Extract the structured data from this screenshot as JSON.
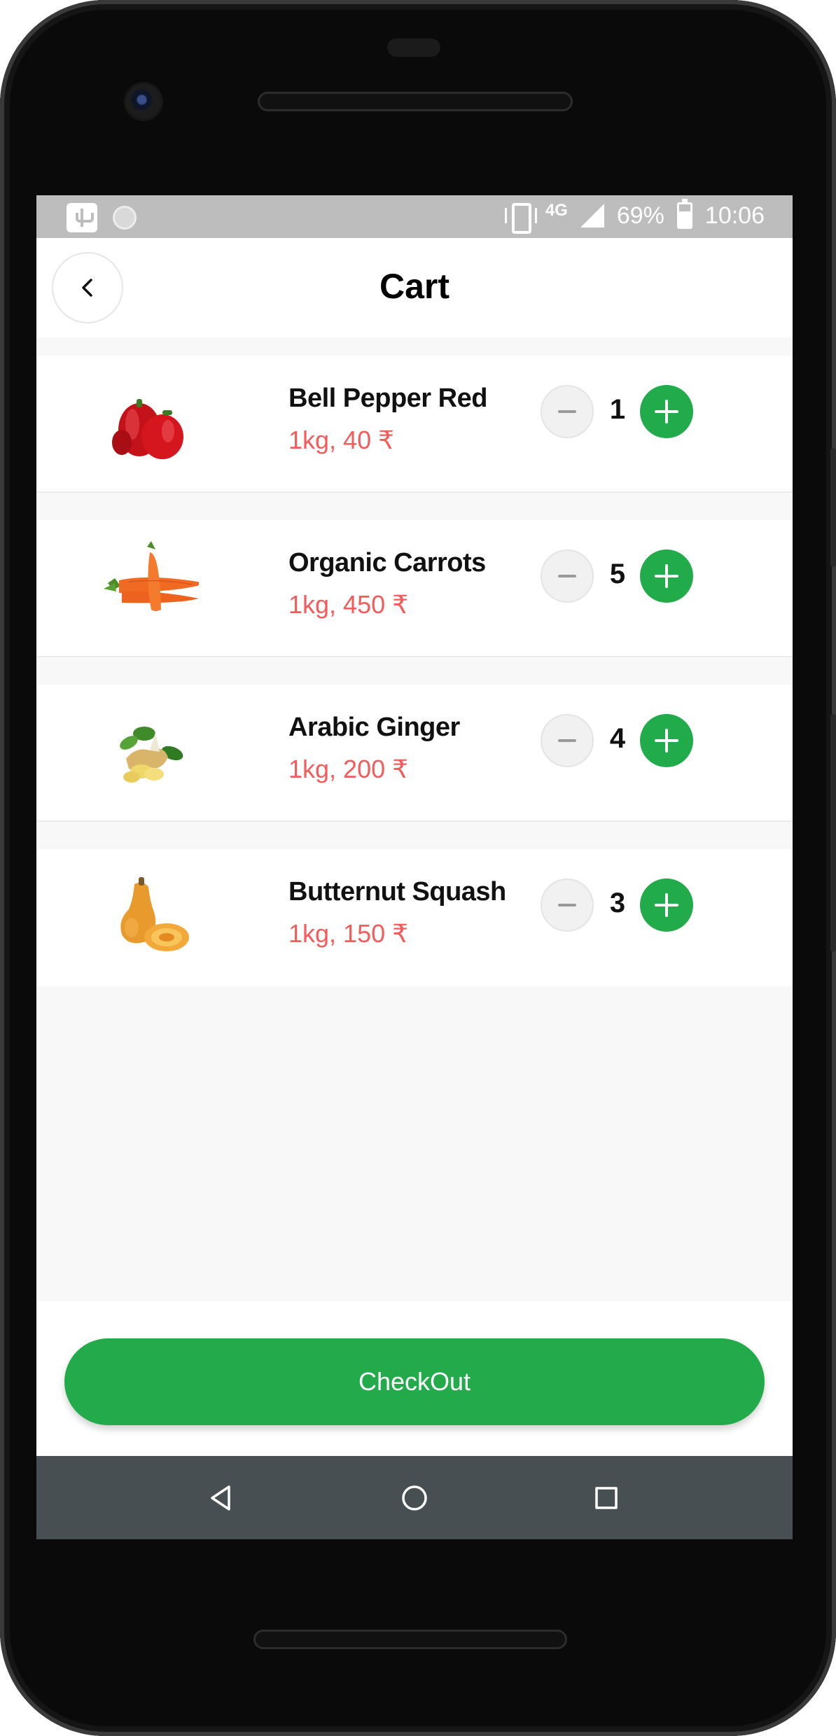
{
  "status_bar": {
    "network": "4G",
    "battery": "69%",
    "time": "10:06",
    "left_icons": [
      "usb-icon",
      "sync-dot-icon"
    ]
  },
  "header": {
    "title": "Cart",
    "back_icon": "chevron-left-icon"
  },
  "cart_items": [
    {
      "name": "Bell Pepper Red",
      "price": "1kg, 40 ₹",
      "quantity": "1",
      "image": "bell-pepper-image"
    },
    {
      "name": "Organic Carrots",
      "price": "1kg, 450 ₹",
      "quantity": "5",
      "image": "carrots-image"
    },
    {
      "name": "Arabic Ginger",
      "price": "1kg, 200 ₹",
      "quantity": "4",
      "image": "ginger-image"
    },
    {
      "name": "Butternut Squash",
      "price": "1kg, 150 ₹",
      "quantity": "3",
      "image": "squash-image"
    }
  ],
  "checkout": {
    "label": "CheckOut"
  },
  "nav_bar": {
    "icons": [
      "back-triangle-icon",
      "home-circle-icon",
      "recents-square-icon"
    ]
  },
  "colors": {
    "accent_green": "#23ab4b",
    "price_red": "#f45b5b",
    "status_bar": "#bdbdbd",
    "nav_bar": "#474f52"
  }
}
